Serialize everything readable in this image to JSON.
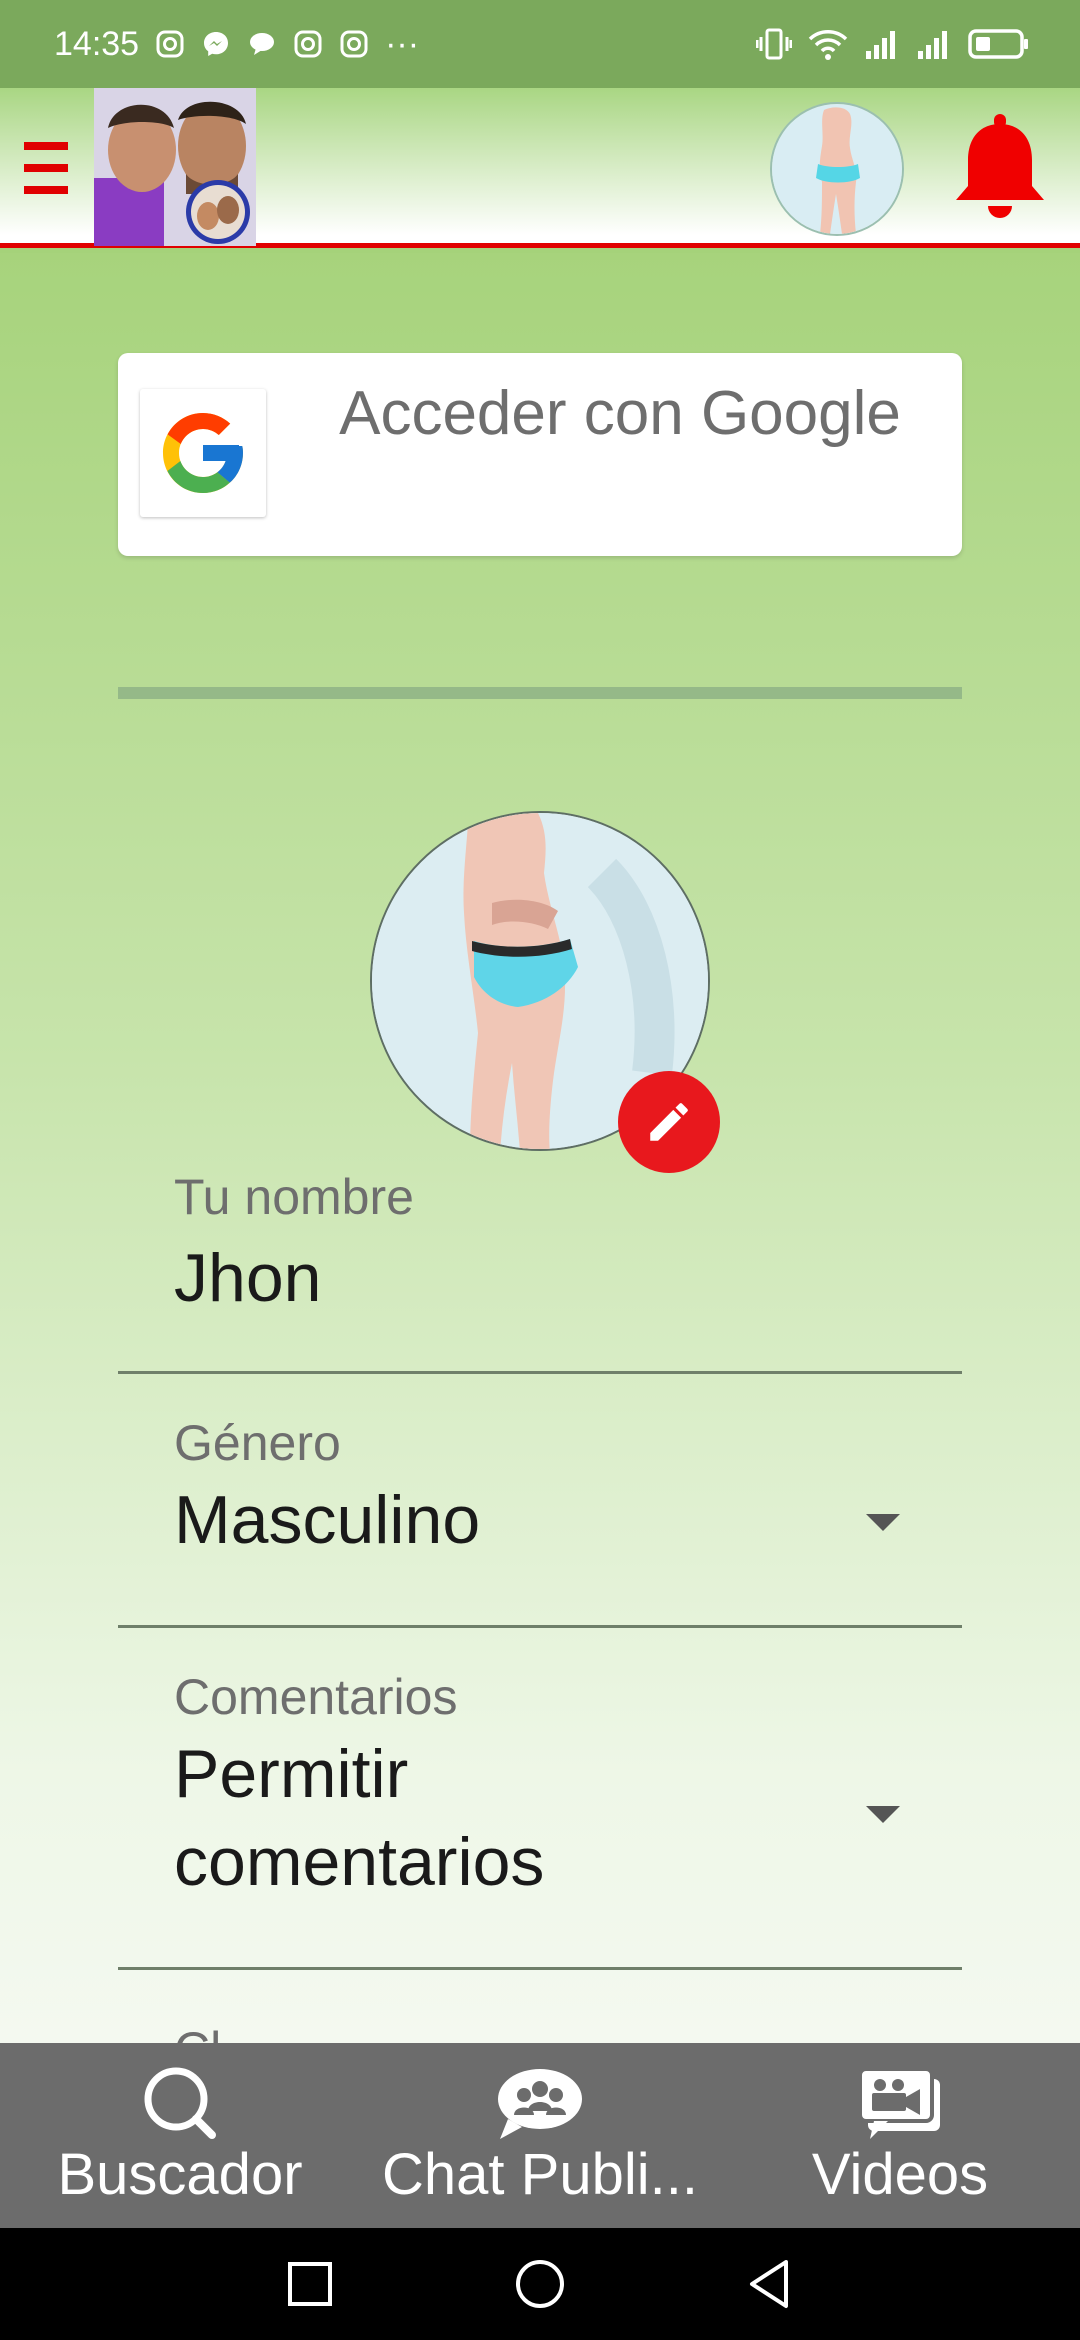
{
  "status_bar": {
    "time": "14:35",
    "more": "···"
  },
  "app_bar": {
    "menu_icon": "hamburger-menu-icon",
    "logo": "app-logo",
    "notification_icon": "bell-icon",
    "accent_color": "#e00000"
  },
  "google_signin": {
    "label": "Acceder con Google"
  },
  "profile": {
    "name_field": {
      "label": "Tu nombre",
      "value": "Jhon"
    },
    "gender_field": {
      "label": "Género",
      "value": "Masculino"
    },
    "comments_field": {
      "label": "Comentarios",
      "value": "Permitir comentarios"
    },
    "next_field_label": "Cl"
  },
  "bottom_nav": {
    "items": [
      {
        "label": "Buscador",
        "icon": "search-icon"
      },
      {
        "label": "Chat Publi...",
        "icon": "group-chat-icon"
      },
      {
        "label": "Videos",
        "icon": "video-chat-icon"
      }
    ]
  },
  "colors": {
    "background_green": "#a5d27a",
    "status_bar": "#7ba95c",
    "accent_red": "#e8181d",
    "bottom_nav": "#6c6c6c"
  }
}
